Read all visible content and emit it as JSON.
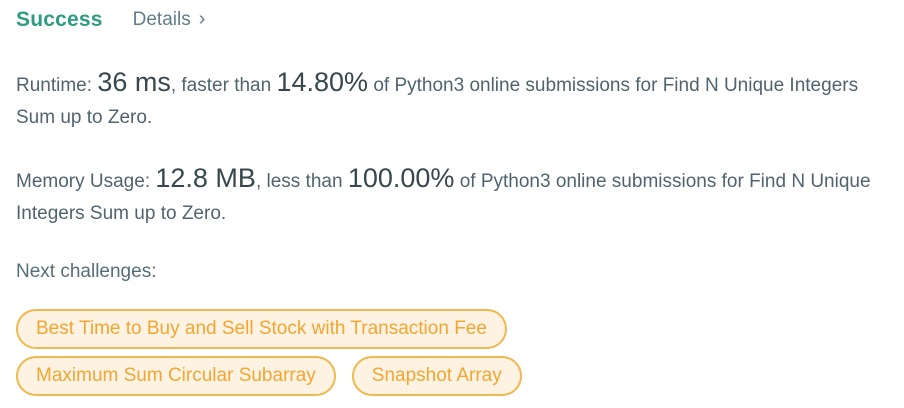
{
  "header": {
    "status": "Success",
    "details_label": "Details",
    "details_chevron": "›"
  },
  "runtime": {
    "label": "Runtime: ",
    "value": "36 ms",
    "comparison_prefix": ", faster than ",
    "percent": "14.80%",
    "suffix": " of Python3 online submissions for Find N Unique Integers Sum up to Zero."
  },
  "memory": {
    "label": "Memory Usage: ",
    "value": "12.8 MB",
    "comparison_prefix": ", less than ",
    "percent": "100.00%",
    "suffix": " of Python3 online submissions for Find N Unique Integers Sum up to Zero."
  },
  "next": {
    "label": "Next challenges:",
    "challenges": [
      "Best Time to Buy and Sell Stock with Transaction Fee",
      "Maximum Sum Circular Subarray",
      "Snapshot Array"
    ]
  },
  "colors": {
    "success": "#2e9b82",
    "chip_border": "#f0b84e",
    "chip_text": "#f2a531",
    "chip_bg": "#fef3e3"
  },
  "icons": {
    "details": "chevron-right-icon"
  }
}
